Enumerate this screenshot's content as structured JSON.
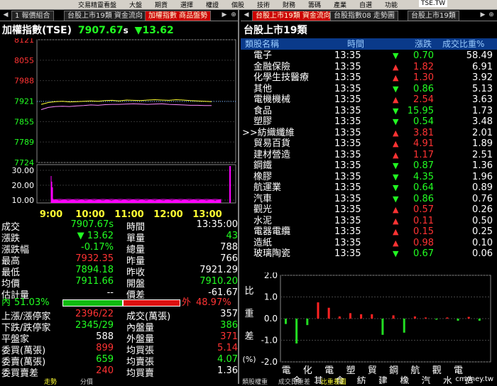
{
  "toolbar": {
    "items": [
      "交易精靈",
      "看盤",
      "大盤",
      "期貨",
      "選擇",
      "權證",
      "個股",
      "技術",
      "財務",
      "籌碼",
      "產業",
      "自選",
      "功能"
    ],
    "symbol": "TSE.TW"
  },
  "left": {
    "tabs": [
      "1 報價組合",
      "台股上市19類 資金流向",
      "加權指數 商品盤勢"
    ],
    "active_tab": 2,
    "title": "加權指數(TSE)",
    "price": "7907.67",
    "price_suffix": "s",
    "change": "13.62",
    "y_ticks": [
      "8121",
      "8055",
      "7988",
      "7921",
      "7855",
      "7789",
      "7724"
    ],
    "vol_ticks": [
      "30.00",
      "20.00",
      "10.00"
    ],
    "x_ticks": [
      "9:00",
      "10:00",
      "11:00",
      "12:00",
      "13:00"
    ],
    "stats_left": [
      {
        "label": "成交",
        "value": "7907.67s"
      },
      {
        "label": "漲跌",
        "value": "▼ 13.62"
      },
      {
        "label": "漲跌幅",
        "value": "-0.17%"
      },
      {
        "label": "最高",
        "value": "7932.35"
      },
      {
        "label": "最低",
        "value": "7894.18"
      },
      {
        "label": "均價",
        "value": "7911.66"
      },
      {
        "label": "估計量",
        "value": "--"
      }
    ],
    "stats_right": [
      {
        "label": "時間",
        "value": "13:35:00"
      },
      {
        "label": "單量",
        "value": "43"
      },
      {
        "label": "總量",
        "value": "788"
      },
      {
        "label": "昨量",
        "value": "766"
      },
      {
        "label": "昨收",
        "value": "7921.29"
      },
      {
        "label": "開盤",
        "value": "7910.20"
      },
      {
        "label": "價差",
        "value": "-61.67"
      }
    ],
    "inout": {
      "in_label": "內",
      "in_pct": "51.03%",
      "out_label": "外",
      "out_pct": "48.97%",
      "in_fraction": 0.5103
    },
    "stats2_left": [
      {
        "label": "上漲/漲停家",
        "value": "2396/22"
      },
      {
        "label": "下跌/跌停家",
        "value": "2345/29"
      },
      {
        "label": "平盤家",
        "value": "588"
      },
      {
        "label": "委買(萬張)",
        "value": "899"
      },
      {
        "label": "委賣(萬張)",
        "value": "659"
      },
      {
        "label": "委買賣差",
        "value": "240"
      }
    ],
    "stats2_right": [
      {
        "label": "成交(萬張)",
        "value": "357"
      },
      {
        "label": "內盤量",
        "value": "386"
      },
      {
        "label": "外盤量",
        "value": "371"
      },
      {
        "label": "均買張",
        "value": "5.14"
      },
      {
        "label": "均賣張",
        "value": "4.07"
      },
      {
        "label": "均買賣",
        "value": "1.36"
      }
    ],
    "bottom_tabs": [
      "走勢",
      "分價"
    ]
  },
  "right": {
    "tabs": [
      "台股上市19類 資金流向",
      "台股指數08 走勢圖",
      "台股上市19類"
    ],
    "active_tab": 0,
    "title": "台股上市19類",
    "headers": [
      "類股名稱",
      "時間",
      "漲跌",
      "成交比重%"
    ],
    "rows": [
      {
        "name": "電子",
        "time": "13:35",
        "dir": "down",
        "change": "0.70",
        "weight": "58.49"
      },
      {
        "name": "金融保險",
        "time": "13:35",
        "dir": "up",
        "change": "1.82",
        "weight": "6.91"
      },
      {
        "name": "化學生技醫療",
        "time": "13:35",
        "dir": "up",
        "change": "1.30",
        "weight": "3.92"
      },
      {
        "name": "其他",
        "time": "13:35",
        "dir": "down",
        "change": "0.86",
        "weight": "5.13"
      },
      {
        "name": "電機機械",
        "time": "13:35",
        "dir": "up",
        "change": "2.54",
        "weight": "3.63"
      },
      {
        "name": "食品",
        "time": "13:35",
        "dir": "down",
        "change": "15.95",
        "weight": "1.73"
      },
      {
        "name": "塑膠",
        "time": "13:35",
        "dir": "down",
        "change": "0.54",
        "weight": "3.48"
      },
      {
        "name": ">>紡織纖維",
        "time": "13:35",
        "dir": "up",
        "change": "3.81",
        "weight": "2.01"
      },
      {
        "name": "貿易百貨",
        "time": "13:35",
        "dir": "up",
        "change": "4.91",
        "weight": "1.89"
      },
      {
        "name": "建材營造",
        "time": "13:35",
        "dir": "up",
        "change": "1.17",
        "weight": "2.51"
      },
      {
        "name": "鋼鐵",
        "time": "13:35",
        "dir": "down",
        "change": "0.87",
        "weight": "1.36"
      },
      {
        "name": "橡膠",
        "time": "13:35",
        "dir": "down",
        "change": "4.35",
        "weight": "1.96"
      },
      {
        "name": "航運業",
        "time": "13:35",
        "dir": "down",
        "change": "0.64",
        "weight": "0.89"
      },
      {
        "name": "汽車",
        "time": "13:35",
        "dir": "down",
        "change": "0.86",
        "weight": "0.76"
      },
      {
        "name": "觀光",
        "time": "13:35",
        "dir": "up",
        "change": "0.57",
        "weight": "0.26"
      },
      {
        "name": "水泥",
        "time": "13:35",
        "dir": "up",
        "change": "0.11",
        "weight": "0.50"
      },
      {
        "name": "電器電纜",
        "time": "13:35",
        "dir": "up",
        "change": "0.15",
        "weight": "0.25"
      },
      {
        "name": "造紙",
        "time": "13:35",
        "dir": "up",
        "change": "0.98",
        "weight": "0.10"
      },
      {
        "name": "玻璃陶瓷",
        "time": "13:35",
        "dir": "down",
        "change": "0.67",
        "weight": "0.06"
      }
    ],
    "bar_ylabel": [
      "比",
      "重",
      "差",
      "(%)"
    ],
    "bar_yticks": [
      "2.0",
      "1.0",
      "0.0",
      "-1.0",
      "-2.0"
    ],
    "bar_xlabels_top": [
      "電",
      "化",
      "電",
      "塑",
      "貿",
      "鋼",
      "航",
      "觀",
      "電"
    ],
    "bar_xlabels_bottom": [
      "金",
      "其",
      "食",
      "紡",
      "建",
      "橡",
      "汽",
      "水",
      "造"
    ],
    "watermark": "cmoney.tw",
    "bottom_tabs": [
      "類股權重",
      "成交比重差",
      "比重差圖"
    ]
  },
  "chart_data": [
    {
      "type": "line",
      "title": "加權指數(TSE)",
      "ylim": [
        7724,
        8121
      ],
      "series": [
        {
          "name": "",
          "color": "#ffff33",
          "values": [
            7912,
            7918,
            7921,
            7922,
            7920,
            7921,
            7922,
            7923,
            7922,
            7924,
            7925,
            7923,
            7926,
            7925,
            7924,
            7926,
            7927,
            7926,
            7925,
            7927,
            7926,
            7924,
            7923,
            7922,
            7921
          ]
        },
        {
          "name": "",
          "color": "#ff88ff",
          "values": [
            7895,
            7902,
            7905,
            7906,
            7905,
            7907,
            7908,
            7910,
            7909,
            7911,
            7912,
            7912,
            7913,
            7914,
            7913,
            7912,
            7913,
            7914,
            7912,
            7911,
            7910,
            7909,
            7909,
            7908,
            7908
          ]
        }
      ],
      "x": [
        "9:00",
        "10:00",
        "11:00",
        "12:00",
        "13:00"
      ]
    },
    {
      "type": "bar",
      "title": "",
      "ylim": [
        -2.0,
        2.0
      ],
      "categories": [
        "電子",
        "金融保險",
        "化學生技醫療",
        "其他",
        "電機機械",
        "食品",
        "塑膠",
        "紡織纖維",
        "貿易百貨",
        "建材營造",
        "鋼鐵",
        "橡膠",
        "航運業",
        "汽車",
        "觀光",
        "水泥",
        "電器電纜",
        "造紙",
        "玻璃陶瓷"
      ],
      "values": [
        -0.25,
        -1.15,
        -0.3,
        0.75,
        0.5,
        0.1,
        0.25,
        0.2,
        0.2,
        -0.75,
        0.15,
        -0.65,
        0.1,
        0.05,
        -0.05,
        0.05,
        -0.1,
        0.08,
        -0.1
      ]
    }
  ]
}
